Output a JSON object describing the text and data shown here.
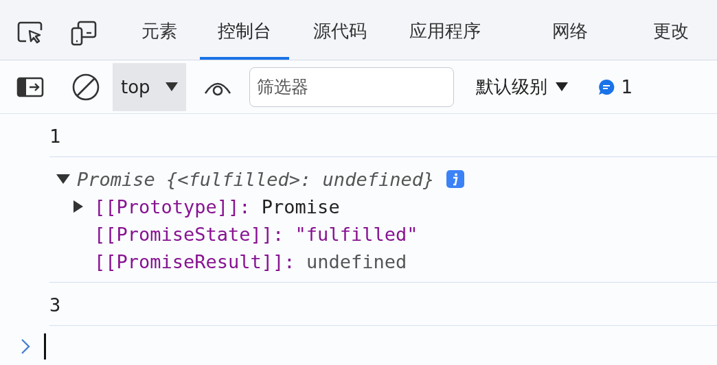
{
  "toolbar_icons": [
    {
      "kind": "inspect"
    },
    {
      "kind": "device"
    }
  ],
  "tabs": [
    {
      "label": "元素",
      "selected": false
    },
    {
      "label": "控制台",
      "selected": true
    },
    {
      "label": "源代码",
      "selected": false
    },
    {
      "label": "应用程序",
      "selected": false
    },
    {
      "label": "网络",
      "selected": false
    },
    {
      "label": "更改",
      "selected": false
    }
  ],
  "console_toolbar": {
    "context": "top",
    "filter": {
      "placeholder": "筛选器"
    },
    "level": "默认级别",
    "message_count": "1"
  },
  "messages": [
    {
      "kind": "value",
      "text": "1"
    },
    {
      "kind": "object",
      "expanded": true,
      "summary": "Promise {<fulfilled>: undefined}",
      "children": [
        {
          "key": "[[Prototype]]:",
          "value": "Promise",
          "expanded": false,
          "kind": "object"
        },
        {
          "key": "[[PromiseState]]:",
          "value": "\"fulfilled\"",
          "kind": "string"
        },
        {
          "key": "[[PromiseResult]]:",
          "value": "undefined",
          "kind": "undefined"
        }
      ]
    },
    {
      "kind": "value",
      "text": "3"
    }
  ]
}
